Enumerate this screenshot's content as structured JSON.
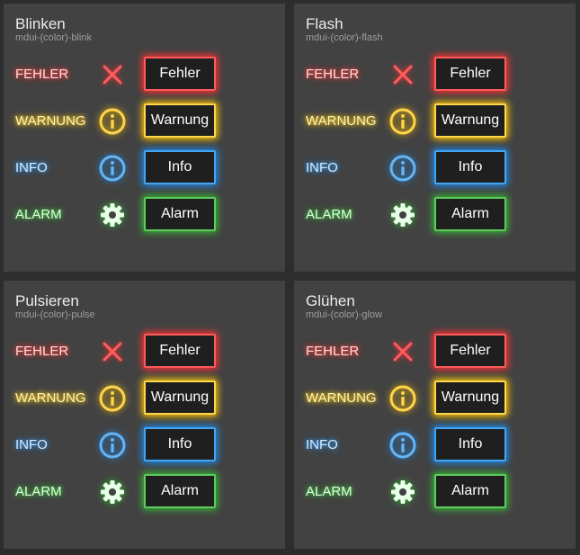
{
  "panels": [
    {
      "title": "Blinken",
      "subtitle": "mdui-(color)-blink"
    },
    {
      "title": "Flash",
      "subtitle": "mdui-(color)-flash"
    },
    {
      "title": "Pulsieren",
      "subtitle": "mdui-(color)-pulse"
    },
    {
      "title": "Glühen",
      "subtitle": "mdui-(color)-glow"
    }
  ],
  "rows": [
    {
      "label": "FEHLER",
      "button": "Fehler",
      "icon": "close-icon",
      "color": "#ff3030"
    },
    {
      "label": "WARNUNG",
      "button": "Warnung",
      "icon": "info-icon",
      "color": "#ffc400"
    },
    {
      "label": "INFO",
      "button": "Info",
      "icon": "info-icon",
      "color": "#1e88e5"
    },
    {
      "label": "ALARM",
      "button": "Alarm",
      "icon": "gear-icon",
      "color": "#36b336"
    }
  ]
}
